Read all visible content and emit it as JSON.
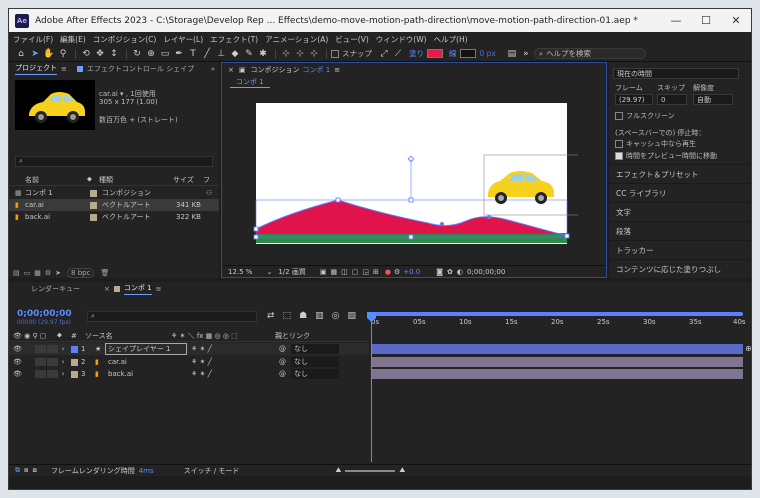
{
  "window": {
    "title": "Adobe After Effects 2023 - C:\\Storage\\Develop Rep ... Effects\\demo-move-motion-path-direction\\move-motion-path-direction-01.aep *",
    "logo": "Ae",
    "min": "—",
    "max": "☐",
    "close": "✕"
  },
  "menu": [
    "ファイル(F)",
    "編集(E)",
    "コンポジション(C)",
    "レイヤー(L)",
    "エフェクト(T)",
    "アニメーション(A)",
    "ビュー(V)",
    "ウィンドウ(W)",
    "ヘルプ(H)"
  ],
  "toolbar": {
    "snap": "スナップ",
    "fill": "塗り",
    "stroke": "線",
    "stroke_px": "0 px",
    "help_search": "ヘルプを検索"
  },
  "project": {
    "tab": "プロジェクト",
    "tab2": "エフェクトコントロール シェイプ",
    "asset_name": "car.ai ▾ , 1回使用",
    "asset_dims": "305 x 177 (1.00)",
    "asset_color": "数百万色 + (ストレート)",
    "search_icon": "⌕",
    "col_name": "名前",
    "col_type": "種類",
    "col_size": "サイズ",
    "col_f": "フ",
    "rows": [
      {
        "name": "コンポ 1",
        "type": "コンポジション",
        "size": ""
      },
      {
        "name": "car.ai",
        "type": "ベクトルアート",
        "size": "341 KB"
      },
      {
        "name": "back.ai",
        "type": "ベクトルアート",
        "size": "322 KB"
      }
    ],
    "bpc": "8 bpc"
  },
  "comp": {
    "tab": "コンポジション",
    "tab_name": "コンポ 1",
    "subtab": "コンポ 1",
    "zoom": "12.5 %",
    "quality": "1/2 画質",
    "exposure": "+0.0",
    "timecode": "0;00;00;00"
  },
  "right": {
    "preview_label": "現在の時間",
    "frame_label": "フレーム",
    "skip_label": "スキップ",
    "res_label": "解像度",
    "frame_val": "(29.97)",
    "skip_val": "0",
    "res_val": "自動",
    "fullscreen": "フルスクリーン",
    "space_label": "(スペースバーでの) 停止時：",
    "cache_label": "キャッシュ中なら再生",
    "move_label": "時間をプレビュー時間に移動",
    "items": [
      "エフェクト＆プリセット",
      "CC ライブラリ",
      "文字",
      "段落",
      "トラッカー",
      "コンテンツに応じた塗りつぶし"
    ]
  },
  "timeline": {
    "tab1": "レンダーキュー",
    "tab2": "コンポ 1",
    "timecode": "0;00;00;00",
    "fps": "00000 (29.97 fps)",
    "col_source": "ソース名",
    "col_parent": "親とリンク",
    "layers": [
      {
        "num": "1",
        "name": "シェイプレイヤー 1",
        "parent": "なし"
      },
      {
        "num": "2",
        "name": "car.ai",
        "parent": "なし"
      },
      {
        "num": "3",
        "name": "back.ai",
        "parent": "なし"
      }
    ],
    "ruler": [
      "0s",
      "05s",
      "10s",
      "15s",
      "20s",
      "25s",
      "30s",
      "35s",
      "40s"
    ],
    "render_label": "フレームレンダリング時間",
    "render_val": "4ms",
    "switch_mode": "スイッチ / モード"
  },
  "colors": {
    "fill": "#e11d48",
    "accent": "#6f9cff",
    "hill": "#e0134a",
    "ground": "#2f8a4c",
    "car": "#f6d11e"
  }
}
